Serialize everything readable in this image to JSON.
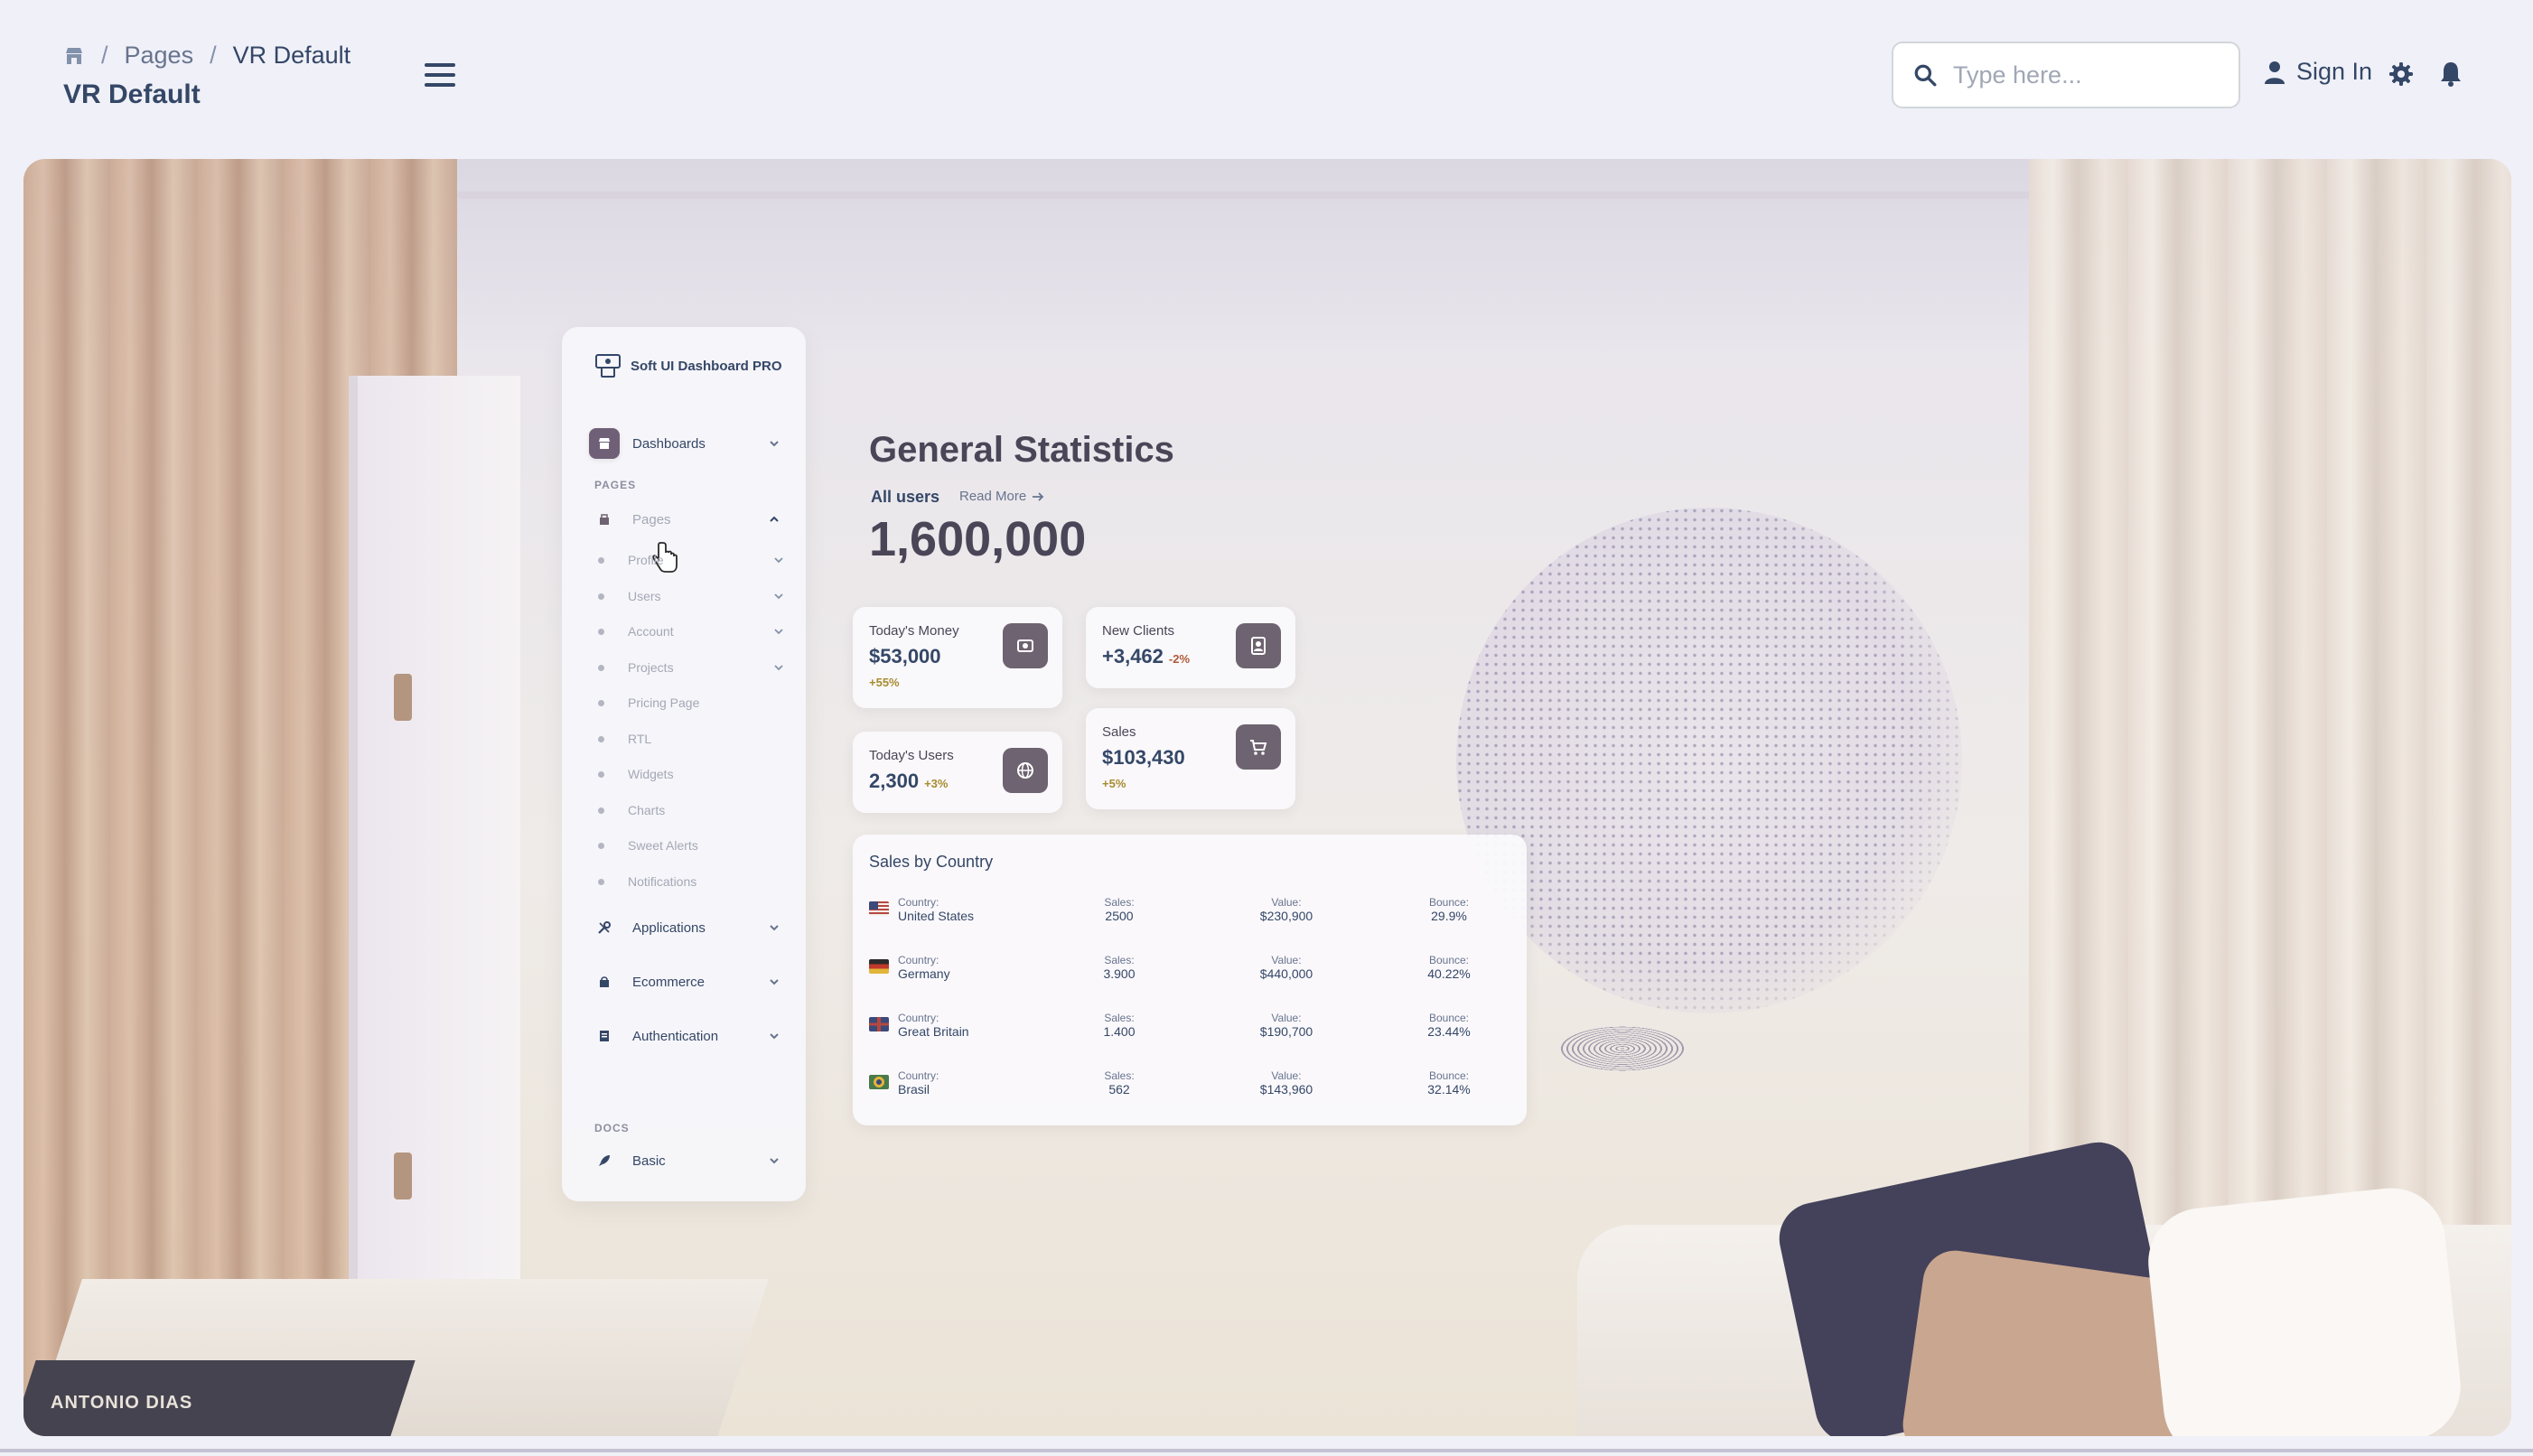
{
  "breadcrumb": {
    "pages": "Pages",
    "current": "VR Default",
    "separator": "/"
  },
  "page_title": "VR Default",
  "search": {
    "placeholder": "Type here..."
  },
  "signin_label": "Sign In",
  "scene": {
    "book_text": "ANTONIO DIAS",
    "sidebar": {
      "brand": "Soft UI Dashboard PRO",
      "dashboards": "Dashboards",
      "pages_section": "PAGES",
      "pages": "Pages",
      "sub_items": [
        "Profile",
        "Users",
        "Account",
        "Projects",
        "Pricing Page",
        "RTL",
        "Widgets",
        "Charts",
        "Sweet Alerts",
        "Notifications"
      ],
      "applications": "Applications",
      "ecommerce": "Ecommerce",
      "authentication": "Authentication",
      "docs_section": "DOCS",
      "basic": "Basic"
    },
    "stats": {
      "title": "General Statistics",
      "subtitle": "All users",
      "read_more": "Read More",
      "value": "1,600,000"
    },
    "cards": {
      "todays_money": {
        "title": "Today's Money",
        "value": "$53,000",
        "delta": "+55%"
      },
      "new_clients": {
        "title": "New Clients",
        "value": "+3,462",
        "delta": "-2%"
      },
      "todays_users": {
        "title": "Today's Users",
        "value": "2,300",
        "delta": "+3%"
      },
      "sales": {
        "title": "Sales",
        "value": "$103,430",
        "delta": "+5%"
      }
    },
    "sales_by_country": {
      "title": "Sales by Country",
      "labels": {
        "country": "Country:",
        "sales": "Sales:",
        "value": "Value:",
        "bounce": "Bounce:"
      },
      "rows": [
        {
          "country": "United States",
          "sales": "2500",
          "value": "$230,900",
          "bounce": "29.9%"
        },
        {
          "country": "Germany",
          "sales": "3.900",
          "value": "$440,000",
          "bounce": "40.22%"
        },
        {
          "country": "Great Britain",
          "sales": "1.400",
          "value": "$190,700",
          "bounce": "23.44%"
        },
        {
          "country": "Brasil",
          "sales": "562",
          "value": "$143,960",
          "bounce": "32.14%"
        }
      ]
    }
  },
  "colors": {
    "accent": "#6e6370",
    "positive": "#a88b2f",
    "negative": "#b05a36",
    "text": "#344767"
  }
}
